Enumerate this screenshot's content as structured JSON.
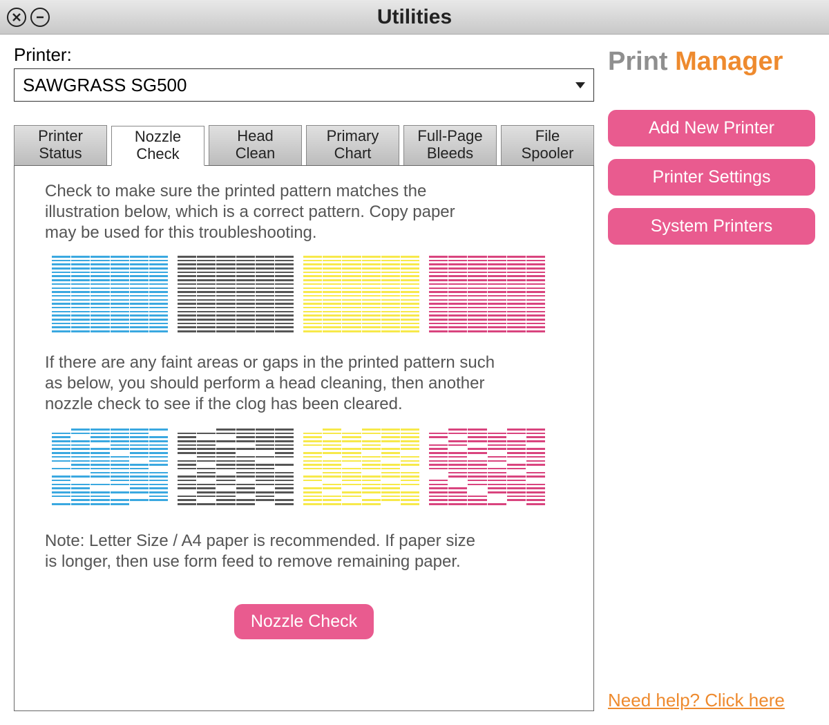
{
  "window": {
    "title": "Utilities"
  },
  "printer": {
    "label": "Printer:",
    "selected": "SAWGRASS SG500"
  },
  "tabs": [
    {
      "label": "Printer\nStatus"
    },
    {
      "label": "Nozzle\nCheck",
      "active": true
    },
    {
      "label": "Head\nClean"
    },
    {
      "label": "Primary\nChart"
    },
    {
      "label": "Full-Page\nBleeds"
    },
    {
      "label": "File\nSpooler"
    }
  ],
  "content": {
    "instruction1": "Check to make sure the printed pattern matches the illustration below, which is a correct pattern. Copy paper may be used for this troubleshooting.",
    "instruction2": "If there are any faint areas or gaps in the printed pattern such as below, you should perform a head cleaning, then another nozzle check to see if the clog has been cleared.",
    "note": "Note: Letter Size / A4 paper is recommended.  If paper size is longer, then use form feed to remove remaining paper.",
    "action_button": "Nozzle Check",
    "pattern_colors": [
      "#3aa8e0",
      "#555555",
      "#f7e94a",
      "#d9447e"
    ]
  },
  "logo": {
    "word1": "Print",
    "word2": "Manager"
  },
  "side_buttons": {
    "add": "Add New Printer",
    "settings": "Printer Settings",
    "system": "System Printers"
  },
  "help_link": "Need help? Click here"
}
